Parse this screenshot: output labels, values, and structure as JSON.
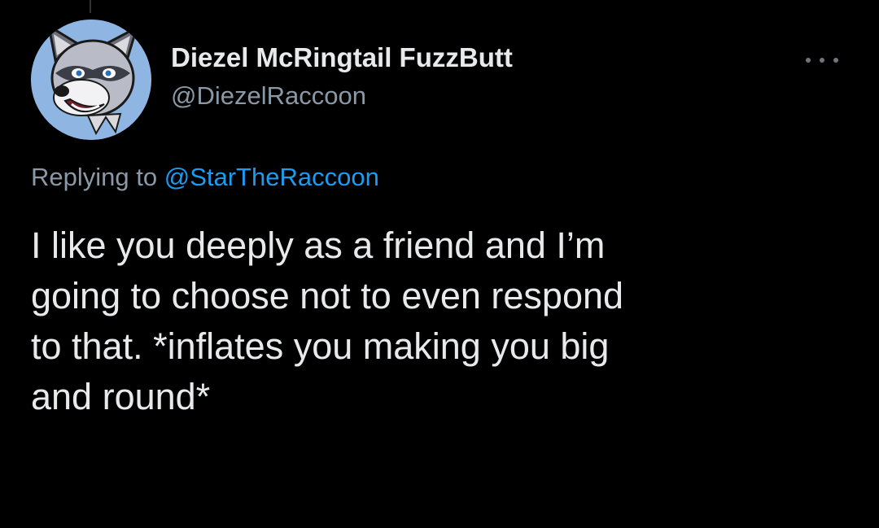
{
  "tweet": {
    "author": {
      "display_name": "Diezel McRingtail FuzzButt",
      "handle": "@DiezelRaccoon",
      "avatar_icon": "raccoon-avatar-icon"
    },
    "reply_context": {
      "prefix": "Replying to ",
      "mention": "@StarTheRaccoon"
    },
    "text_lines": [
      "I like you deeply as a friend and I’m",
      "going to choose not to even respond",
      "to that. *inflates you making you big",
      "and round*"
    ],
    "more_icon": "more-options-icon"
  },
  "colors": {
    "background": "#000000",
    "primary_text": "#e7e9ea",
    "secondary_text": "#8b98a5",
    "link": "#1d9bf0"
  }
}
